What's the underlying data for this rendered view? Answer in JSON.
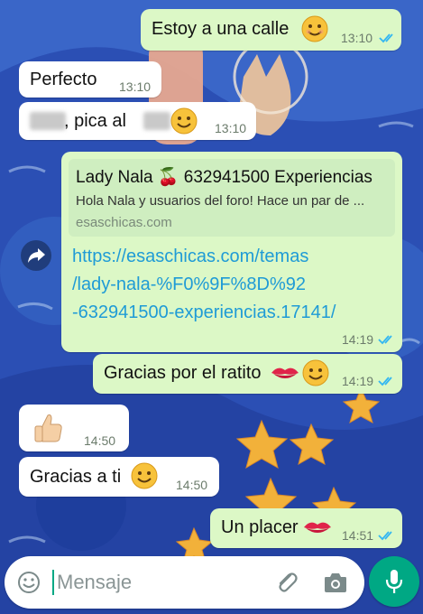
{
  "messages": [
    {
      "text": "Estoy a una calle",
      "time": "13:10"
    },
    {
      "text": "Perfecto",
      "time": "13:10"
    },
    {
      "text": ", pica al",
      "time": "13:10"
    },
    {
      "link_preview": {
        "title": "Lady Nala 🍒 632941500 Experiencias",
        "description": "Hola Nala y usuarios del foro! Hace un par de ...",
        "domain": "esaschicas.com"
      },
      "link_lines": [
        "https://esaschicas.com/temas",
        "/lady-nala-%F0%9F%8D%92",
        "-632941500-experiencias.17141/"
      ],
      "time": "14:19"
    },
    {
      "text": "Gracias por el ratito",
      "time": "14:19"
    },
    {
      "time": "14:50"
    },
    {
      "text": "Gracias a ti",
      "time": "14:50"
    },
    {
      "text": "Un placer",
      "time": "14:51"
    }
  ],
  "composer": {
    "placeholder": "Mensaje"
  },
  "colors": {
    "outgoing_bubble": "#dcf8c6",
    "incoming_bubble": "#ffffff",
    "link": "#1f9bd6",
    "read_ticks": "#34b7f1",
    "mic_button": "#00a884"
  },
  "icons": [
    "forward-icon",
    "emoji-icon",
    "attach-icon",
    "camera-icon",
    "mic-icon",
    "read-ticks-icon"
  ]
}
